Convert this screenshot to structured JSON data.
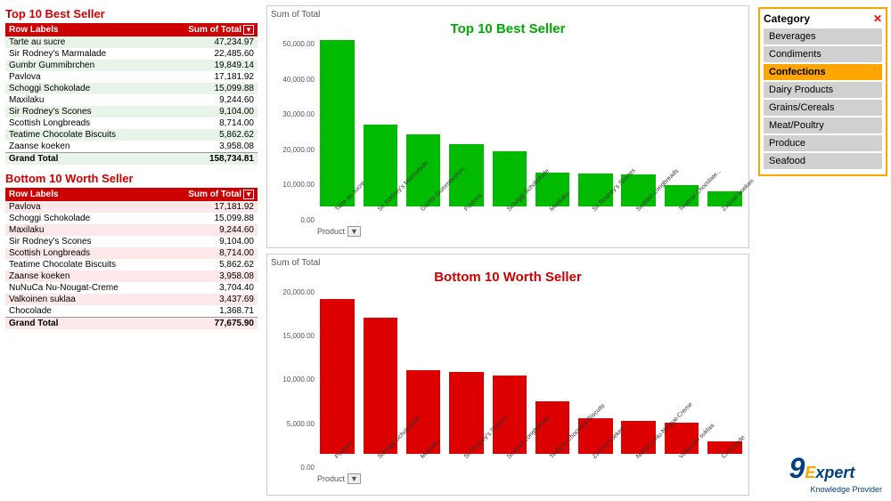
{
  "top_table": {
    "title": "Top 10 Best Seller",
    "headers": [
      "Row Labels",
      "Sum of Total"
    ],
    "rows": [
      [
        "Tarte au sucre",
        "47,234.97"
      ],
      [
        "Sir Rodney's Marmalade",
        "22,485.60"
      ],
      [
        "Gumbr Gummibrchen",
        "19,849.14"
      ],
      [
        "Pavlova",
        "17,181.92"
      ],
      [
        "Schoggi Schokolade",
        "15,099.88"
      ],
      [
        "Maxilaku",
        "9,244.60"
      ],
      [
        "Sir Rodney's Scones",
        "9,104.00"
      ],
      [
        "Scottish Longbreads",
        "8,714.00"
      ],
      [
        "Teatime Chocolate Biscuits",
        "5,862.62"
      ],
      [
        "Zaanse koeken",
        "3,958.08"
      ]
    ],
    "grand_total": [
      "Grand Total",
      "158,734.81"
    ]
  },
  "bottom_table": {
    "title": "Bottom 10 Worth Seller",
    "headers": [
      "Row Labels",
      "Sum of Total"
    ],
    "rows": [
      [
        "Pavlova",
        "17,181.92"
      ],
      [
        "Schoggi Schokolade",
        "15,099.88"
      ],
      [
        "Maxilaku",
        "9,244.60"
      ],
      [
        "Sir Rodney's Scones",
        "9,104.00"
      ],
      [
        "Scottish Longbreads",
        "8,714.00"
      ],
      [
        "Teatime Chocolate Biscuits",
        "5,862.62"
      ],
      [
        "Zaanse koeken",
        "3,958.08"
      ],
      [
        "NuNuCa Nu-Nougat-Creme",
        "3,704.40"
      ],
      [
        "Valkoinen suklaa",
        "3,437.69"
      ],
      [
        "Chocolade",
        "1,368.71"
      ]
    ],
    "grand_total": [
      "Grand Total",
      "77,675.90"
    ]
  },
  "top_chart": {
    "title": "Top 10 Best Seller",
    "color": "green",
    "sum_label": "Sum of Total",
    "y_labels": [
      "50,000.00",
      "40,000.00",
      "30,000.00",
      "20,000.00",
      "10,000.00",
      "0.00"
    ],
    "bars": [
      {
        "label": "Tarte au sucre",
        "value": 47234.97,
        "max": 50000
      },
      {
        "label": "Sir Rodney's Marmalade",
        "value": 22485.6,
        "max": 50000
      },
      {
        "label": "Gumbr Gummibrchen",
        "value": 19849.14,
        "max": 50000
      },
      {
        "label": "Pavlova",
        "value": 17181.92,
        "max": 50000
      },
      {
        "label": "Schoggi Schokolade",
        "value": 15099.88,
        "max": 50000
      },
      {
        "label": "Maxilaku",
        "value": 9244.6,
        "max": 50000
      },
      {
        "label": "Sir Rodney's Scones",
        "value": 9104.0,
        "max": 50000
      },
      {
        "label": "Scottish Longbreads",
        "value": 8714.0,
        "max": 50000
      },
      {
        "label": "Teatime Chocolate...",
        "value": 5862.62,
        "max": 50000
      },
      {
        "label": "Zaanse koeken",
        "value": 3958.08,
        "max": 50000
      }
    ],
    "x_label": "Product"
  },
  "bottom_chart": {
    "title": "Bottom 10 Worth Seller",
    "color": "red",
    "sum_label": "Sum of Total",
    "y_labels": [
      "20,000.00",
      "15,000.00",
      "10,000.00",
      "5,000.00",
      "0.00"
    ],
    "bars": [
      {
        "label": "Pavlova",
        "value": 17181.92,
        "max": 20000
      },
      {
        "label": "Schoggi Schokolade",
        "value": 15099.88,
        "max": 20000
      },
      {
        "label": "Maxilaku",
        "value": 9244.6,
        "max": 20000
      },
      {
        "label": "Sir Rodney's Scones",
        "value": 9104.0,
        "max": 20000
      },
      {
        "label": "Scottish Longbreads",
        "value": 8714.0,
        "max": 20000
      },
      {
        "label": "Teatime Chocolate Biscuits",
        "value": 5862.62,
        "max": 20000
      },
      {
        "label": "Zaanse koeken",
        "value": 3958.08,
        "max": 20000
      },
      {
        "label": "NuNuCa Nu-Nougat-Creme",
        "value": 3704.4,
        "max": 20000
      },
      {
        "label": "Valkoinen suklaa",
        "value": 3437.69,
        "max": 20000
      },
      {
        "label": "Chocolade",
        "value": 1368.71,
        "max": 20000
      }
    ],
    "x_label": "Product"
  },
  "category": {
    "title": "Category",
    "items": [
      {
        "label": "Beverages",
        "active": false
      },
      {
        "label": "Condiments",
        "active": false
      },
      {
        "label": "Confections",
        "active": true
      },
      {
        "label": "Dairy Products",
        "active": false
      },
      {
        "label": "Grains/Cereals",
        "active": false
      },
      {
        "label": "Meat/Poultry",
        "active": false
      },
      {
        "label": "Produce",
        "active": false
      },
      {
        "label": "Seafood",
        "active": false
      }
    ]
  },
  "logo": {
    "number": "9",
    "word": "Expert",
    "tagline": "Knowledge Provider"
  }
}
